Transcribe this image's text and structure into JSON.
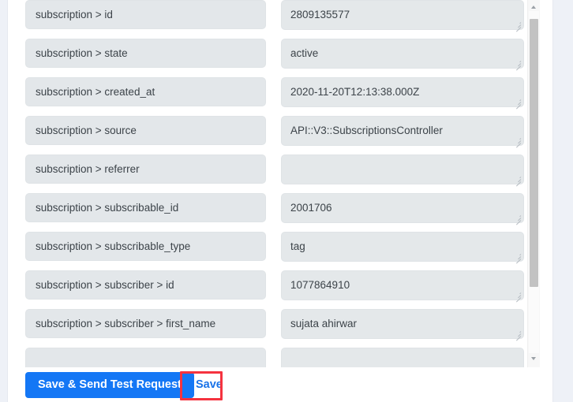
{
  "mapping_rows": [
    {
      "label": "subscription > id",
      "value": "2809135577"
    },
    {
      "label": "subscription > state",
      "value": "active"
    },
    {
      "label": "subscription > created_at",
      "value": "2020-11-20T12:13:38.000Z"
    },
    {
      "label": "subscription > source",
      "value": "API::V3::SubscriptionsController"
    },
    {
      "label": "subscription > referrer",
      "value": ""
    },
    {
      "label": "subscription > subscribable_id",
      "value": "2001706"
    },
    {
      "label": "subscription > subscribable_type",
      "value": "tag"
    },
    {
      "label": "subscription > subscriber > id",
      "value": "1077864910"
    },
    {
      "label": "subscription > subscriber > first_name",
      "value": "sujata ahirwar"
    },
    {
      "label": "",
      "value": ""
    }
  ],
  "footer": {
    "primary_button_label": "Save & Send Test Request",
    "secondary_button_label": "Save"
  },
  "scrollbar": {
    "up_arrow_icon": "chevron-up-icon",
    "down_arrow_icon": "chevron-down-icon"
  },
  "annotation": {
    "color": "#f5333f",
    "target": "Save"
  },
  "colors": {
    "page_background": "#eef1f7",
    "card_background": "#ffffff",
    "field_fill": "#e3e7ea",
    "field_border": "#dfe3e6",
    "text": "#3c4349",
    "primary_button": "#1477f5",
    "link_text": "#1a73e8",
    "scrollbar_thumb": "#c2c2c2"
  }
}
